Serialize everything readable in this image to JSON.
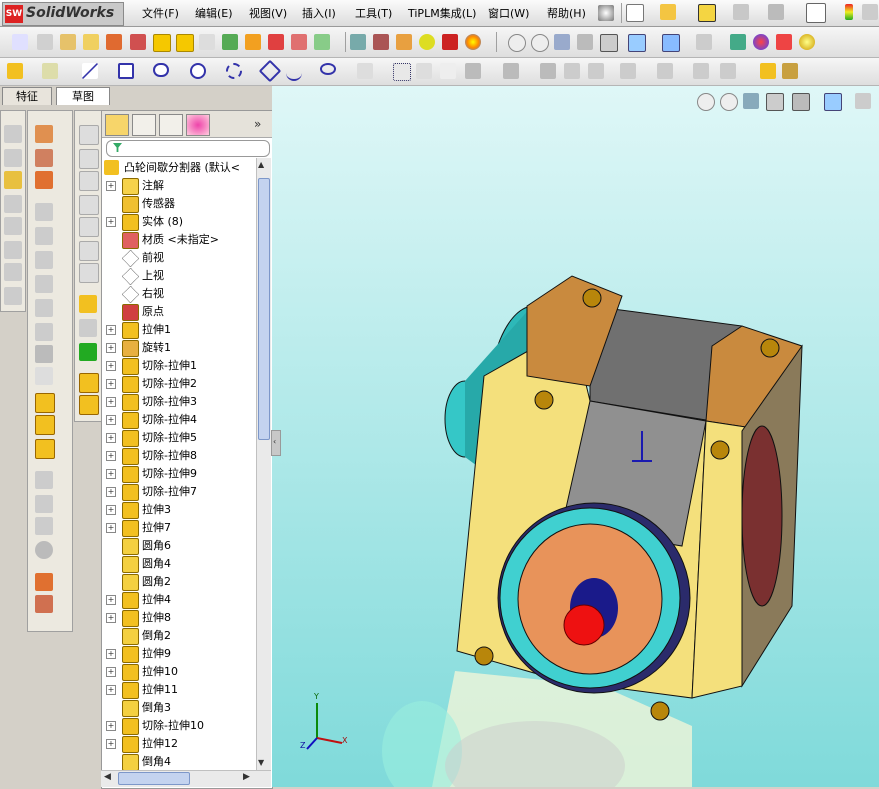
{
  "app": {
    "logo_badge": "SW",
    "name": "SolidWorks"
  },
  "menu": [
    "文件(F)",
    "编辑(E)",
    "视图(V)",
    "插入(I)",
    "工具(T)",
    "TiPLM集成(L)",
    "窗口(W)",
    "帮助(H)"
  ],
  "tabs": [
    {
      "label": "特征",
      "active": false
    },
    {
      "label": "草图",
      "active": true
    }
  ],
  "feature_tree": {
    "root": "凸轮间歇分割器  (默认<",
    "items": [
      {
        "label": "注解",
        "expandable": true,
        "icon": "annotation-icon"
      },
      {
        "label": "传感器",
        "expandable": false,
        "icon": "sensor-icon"
      },
      {
        "label": "实体 (8)",
        "expandable": true,
        "icon": "solid-bodies-icon"
      },
      {
        "label": "材质 <未指定>",
        "expandable": false,
        "icon": "material-icon"
      },
      {
        "label": "前视",
        "expandable": false,
        "icon": "plane-icon"
      },
      {
        "label": "上视",
        "expandable": false,
        "icon": "plane-icon"
      },
      {
        "label": "右视",
        "expandable": false,
        "icon": "plane-icon"
      },
      {
        "label": "原点",
        "expandable": false,
        "icon": "origin-icon"
      },
      {
        "label": "拉伸1",
        "expandable": true,
        "icon": "extrude-icon"
      },
      {
        "label": "旋转1",
        "expandable": true,
        "icon": "revolve-icon"
      },
      {
        "label": "切除-拉伸1",
        "expandable": true,
        "icon": "cut-extrude-icon"
      },
      {
        "label": "切除-拉伸2",
        "expandable": true,
        "icon": "cut-extrude-icon"
      },
      {
        "label": "切除-拉伸3",
        "expandable": true,
        "icon": "cut-extrude-icon"
      },
      {
        "label": "切除-拉伸4",
        "expandable": true,
        "icon": "cut-extrude-icon"
      },
      {
        "label": "切除-拉伸5",
        "expandable": true,
        "icon": "cut-extrude-icon"
      },
      {
        "label": "切除-拉伸8",
        "expandable": true,
        "icon": "cut-extrude-icon"
      },
      {
        "label": "切除-拉伸9",
        "expandable": true,
        "icon": "cut-extrude-icon"
      },
      {
        "label": "切除-拉伸7",
        "expandable": true,
        "icon": "cut-extrude-icon"
      },
      {
        "label": "拉伸3",
        "expandable": true,
        "icon": "extrude-icon"
      },
      {
        "label": "拉伸7",
        "expandable": true,
        "icon": "extrude-icon"
      },
      {
        "label": "圆角6",
        "expandable": false,
        "icon": "fillet-icon"
      },
      {
        "label": "圆角4",
        "expandable": false,
        "icon": "fillet-icon"
      },
      {
        "label": "圆角2",
        "expandable": false,
        "icon": "fillet-icon"
      },
      {
        "label": "拉伸4",
        "expandable": true,
        "icon": "extrude-icon"
      },
      {
        "label": "拉伸8",
        "expandable": true,
        "icon": "extrude-icon"
      },
      {
        "label": "倒角2",
        "expandable": false,
        "icon": "chamfer-icon"
      },
      {
        "label": "拉伸9",
        "expandable": true,
        "icon": "extrude-icon"
      },
      {
        "label": "拉伸10",
        "expandable": true,
        "icon": "extrude-icon"
      },
      {
        "label": "拉伸11",
        "expandable": true,
        "icon": "extrude-icon"
      },
      {
        "label": "倒角3",
        "expandable": false,
        "icon": "chamfer-icon"
      },
      {
        "label": "切除-拉伸10",
        "expandable": true,
        "icon": "cut-extrude-icon"
      },
      {
        "label": "拉伸12",
        "expandable": true,
        "icon": "extrude-icon"
      },
      {
        "label": "倒角4",
        "expandable": false,
        "icon": "chamfer-icon"
      }
    ]
  },
  "triad": {
    "x": "X",
    "y": "Y",
    "z": "Z"
  },
  "colors": {
    "viewport_top": "#dff7f7",
    "viewport_bottom": "#7fdada",
    "part_yellow": "#f5e27a",
    "part_brown": "#c88a3a",
    "part_gray": "#8c8c8c",
    "part_cyan": "#38c8c8",
    "part_orange": "#e8915a",
    "part_red": "#ee1111"
  }
}
